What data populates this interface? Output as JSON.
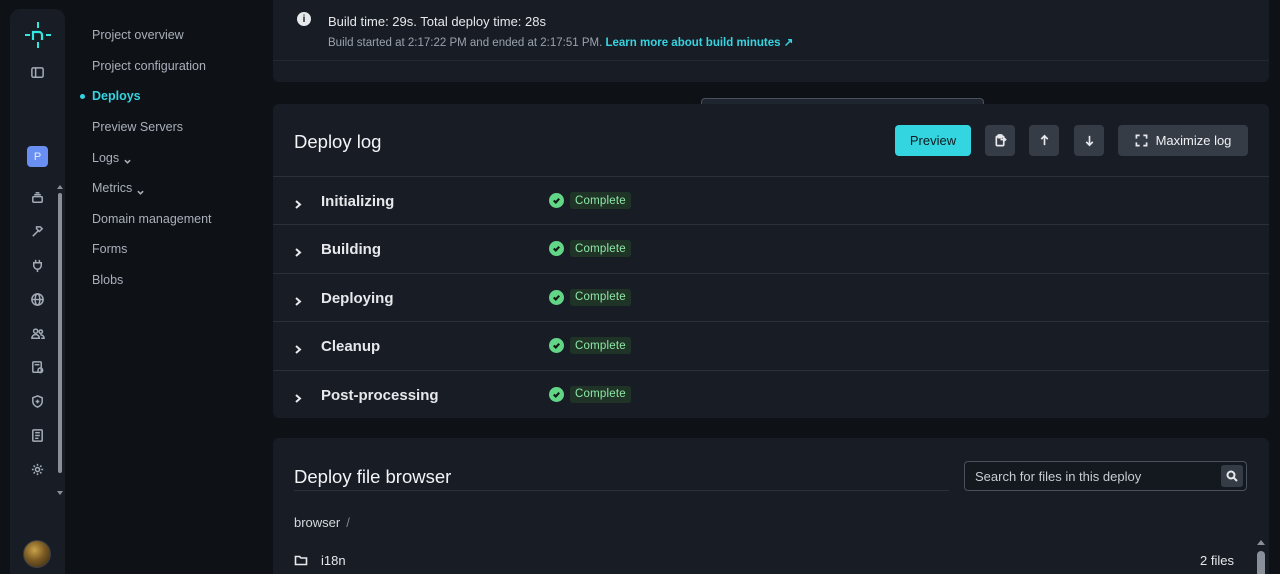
{
  "rail": {
    "project_initial": "P",
    "icons": [
      "sidebar-toggle-icon",
      "search-icon",
      "layers-icon",
      "build-hammer-icon",
      "plug-icon",
      "globe-icon",
      "users-icon",
      "site-settings-icon",
      "shield-icon",
      "log-book-icon",
      "gear-icon"
    ]
  },
  "subnav": {
    "items": [
      {
        "label": "Project overview"
      },
      {
        "label": "Project configuration"
      },
      {
        "label": "Deploys"
      },
      {
        "label": "Preview Servers"
      },
      {
        "label": "Logs"
      },
      {
        "label": "Metrics"
      },
      {
        "label": "Domain management"
      },
      {
        "label": "Forms"
      },
      {
        "label": "Blobs"
      }
    ],
    "active": "Deploys"
  },
  "build": {
    "summary": "Build time: 29s. Total deploy time: 28s",
    "detail": "Build started at 2:17:22 PM and ended at 2:17:51 PM.",
    "link": "Learn more about build minutes ↗"
  },
  "deploy_log": {
    "title": "Deploy log",
    "preview_label": "Preview",
    "maximize_label": "Maximize log",
    "steps": [
      {
        "label": "Initializing",
        "status": "Complete"
      },
      {
        "label": "Building",
        "status": "Complete"
      },
      {
        "label": "Deploying",
        "status": "Complete"
      },
      {
        "label": "Cleanup",
        "status": "Complete"
      },
      {
        "label": "Post-processing",
        "status": "Complete"
      }
    ]
  },
  "file_browser": {
    "title": "Deploy file browser",
    "search_placeholder": "Search for files in this deploy",
    "breadcrumb": "browser",
    "breadcrumb_sep": "/",
    "files": [
      {
        "name": "i18n",
        "count": "2 files"
      }
    ]
  },
  "colors": {
    "accent": "#33d6e0",
    "status_green": "#62d587",
    "card_bg": "#181d25"
  }
}
